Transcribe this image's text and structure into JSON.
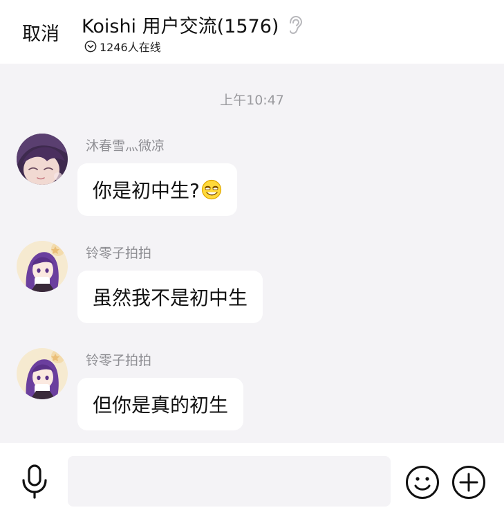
{
  "header": {
    "cancel_label": "取消",
    "title": "Koishi 用户交流(1576)",
    "online_text": "1246人在线"
  },
  "chat": {
    "timestamp": "上午10:47",
    "messages": [
      {
        "sender": "沐春雪灬微凉",
        "text": "你是初中生?",
        "emoji": "smirk-emoji"
      },
      {
        "sender": "铃零子拍拍",
        "text": "虽然我不是初中生"
      },
      {
        "sender": "铃零子拍拍",
        "text": "但你是真的初生"
      }
    ]
  },
  "composer": {
    "input_value": "",
    "input_placeholder": ""
  },
  "icons": {
    "voice": "microphone-icon",
    "emoji": "smiley-icon",
    "plus": "plus-circle-icon"
  }
}
